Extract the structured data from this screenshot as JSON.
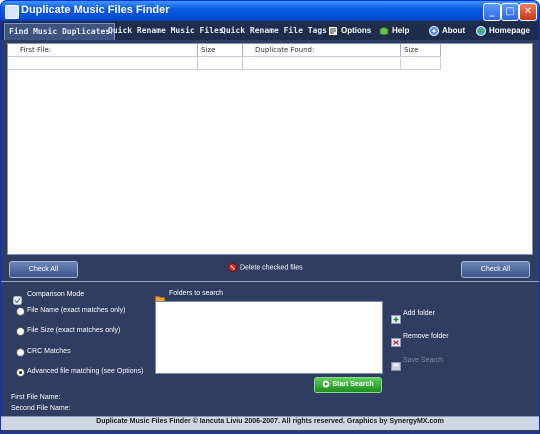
{
  "window": {
    "title": "Duplicate Music Files Finder",
    "controls": {
      "minimize": "_",
      "maximize": "□",
      "close": "✕"
    }
  },
  "tabs": [
    {
      "label": "Find Music Duplicates"
    },
    {
      "label": "Quick Rename Music Files"
    },
    {
      "label": "Quick Rename File Tags"
    }
  ],
  "menu": {
    "options": "Options",
    "help": "Help",
    "about": "About",
    "homepage": "Homepage"
  },
  "results_table": {
    "columns": [
      "First File:",
      "Size",
      "Duplicate Found:",
      "Size"
    ]
  },
  "actions": {
    "check_all_left": "Check All",
    "delete_checked": "Delete checked files",
    "check_all_right": "Check All"
  },
  "comparison": {
    "heading": "Comparison Mode",
    "options": [
      {
        "label": "File Name (exact matches only)",
        "selected": false
      },
      {
        "label": "File Size (exact matches only)",
        "selected": false
      },
      {
        "label": "CRC Matches",
        "selected": false
      },
      {
        "label": "Advanced file matching (see Options)",
        "selected": true
      }
    ]
  },
  "folders": {
    "heading": "Folders to search",
    "add": "Add folder",
    "remove": "Remove folder",
    "save": "Save Search",
    "start": "Start Search"
  },
  "info": {
    "first_file_label": "First File Name:",
    "second_file_label": "Second File Name:"
  },
  "status": "Duplicate Music Files Finder © Iancuta Liviu 2006-2007. All rights reserved. Graphics by SynergyMX.com"
}
